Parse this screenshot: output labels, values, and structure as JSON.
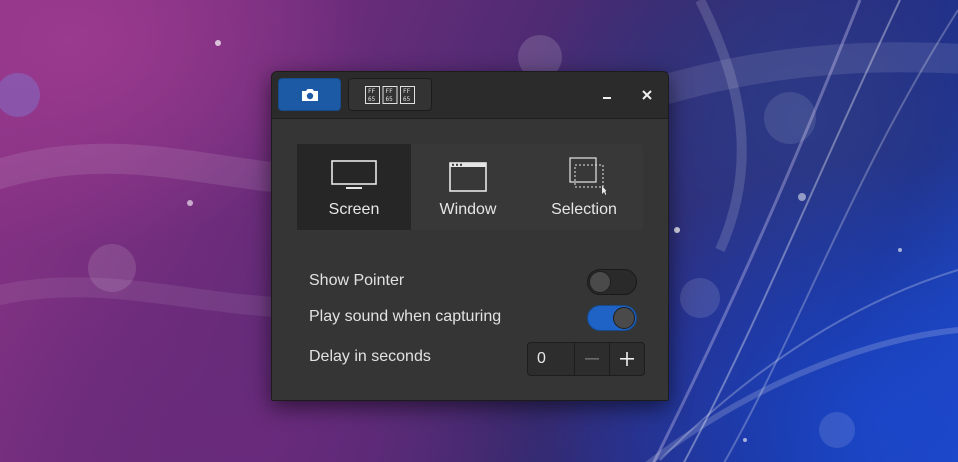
{
  "wallpaper": {
    "description_colors": [
      "#8c3386",
      "#1f4fd0"
    ]
  },
  "headerbar": {
    "camera_button_icon": "camera-icon",
    "history_button_text": "🏳️",
    "history_glyph": "⎕⎕⎕",
    "minimize_icon": "minimize-icon",
    "close_icon": "close-icon",
    "accent": "#1d5aa6"
  },
  "capture_modes": [
    {
      "label": "Screen",
      "icon": "monitor-icon",
      "selected": true
    },
    {
      "label": "Window",
      "icon": "window-icon",
      "selected": false
    },
    {
      "label": "Selection",
      "icon": "selection-icon",
      "selected": false
    }
  ],
  "options": {
    "show_pointer": {
      "label": "Show Pointer",
      "enabled": false
    },
    "play_sound": {
      "label": "Play sound when capturing",
      "enabled": true
    },
    "delay": {
      "label": "Delay in seconds",
      "value": "0",
      "decrement": "−",
      "increment": "+"
    }
  }
}
